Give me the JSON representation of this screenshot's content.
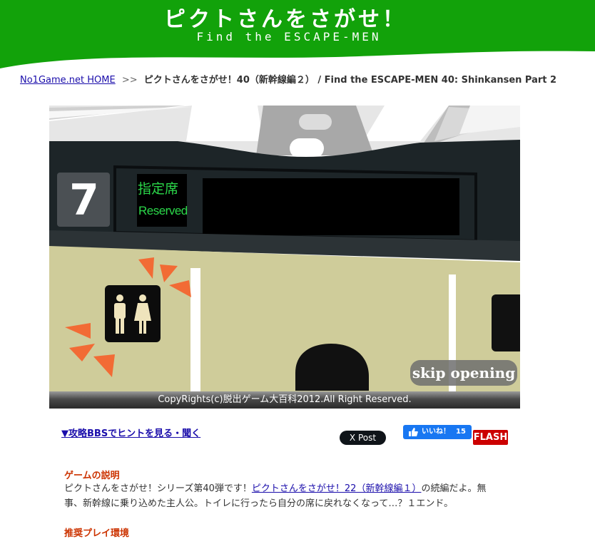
{
  "header": {
    "title": "ピクトさんをさがせ！",
    "subtitle": "Find the ESCAPE-MEN",
    "brand_color": "#12a20a"
  },
  "breadcrumb": {
    "home_label": "No1Game.net HOME",
    "separator": ">>",
    "current": "ピクトさんをさがせ！40（新幹線編２） / Find the ESCAPE-MEN 40: Shinkansen Part 2"
  },
  "game": {
    "car_number": "7",
    "sign_jp": "指定席",
    "sign_en": "Reserved",
    "skip_label": "skip opening",
    "copyright": "CopyRights(c)脱出ゲーム大百科2012.All Right Reserved."
  },
  "actions": {
    "hint_link": "▼攻略BBSでヒントを見る・聞く",
    "x_post_label": "X Post",
    "fb_like_label": "いいね！",
    "fb_like_count": "15",
    "flash_badge": "FLASH"
  },
  "description": {
    "title": "ゲームの説明",
    "text_before": "ピクトさんをさがせ！シリーズ第40弾です！",
    "link_text": "ピクトさんをさがせ！22（新幹線編１）",
    "text_after": "の続編だよ。無事、新幹線に乗り込めた主人公。トイレに行ったら自分の席に戻れなくなって…？１エンド。"
  },
  "env_title": "推奨プレイ環境"
}
